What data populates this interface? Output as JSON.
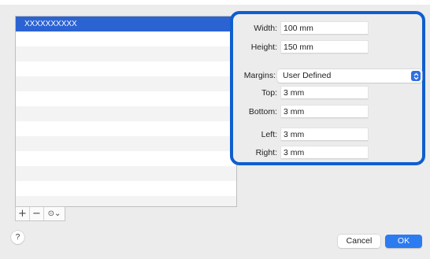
{
  "list": {
    "selected_item": "XXXXXXXXXX",
    "empty_rows": 11
  },
  "list_controls": {
    "add": "+",
    "remove": "−",
    "action": "⊙⌄"
  },
  "form": {
    "width_label": "Width:",
    "width_value": "100 mm",
    "height_label": "Height:",
    "height_value": "150 mm",
    "margins_label": "Margins:",
    "margins_value": "User Defined",
    "top_label": "Top:",
    "top_value": "3 mm",
    "bottom_label": "Bottom:",
    "bottom_value": "3 mm",
    "left_label": "Left:",
    "left_value": "3 mm",
    "right_label": "Right:",
    "right_value": "3 mm"
  },
  "footer": {
    "help": "?",
    "cancel": "Cancel",
    "ok": "OK"
  },
  "colors": {
    "highlight_border": "#0f5ecf",
    "selection": "#2c63d3",
    "primary_button": "#2c7bf0"
  }
}
